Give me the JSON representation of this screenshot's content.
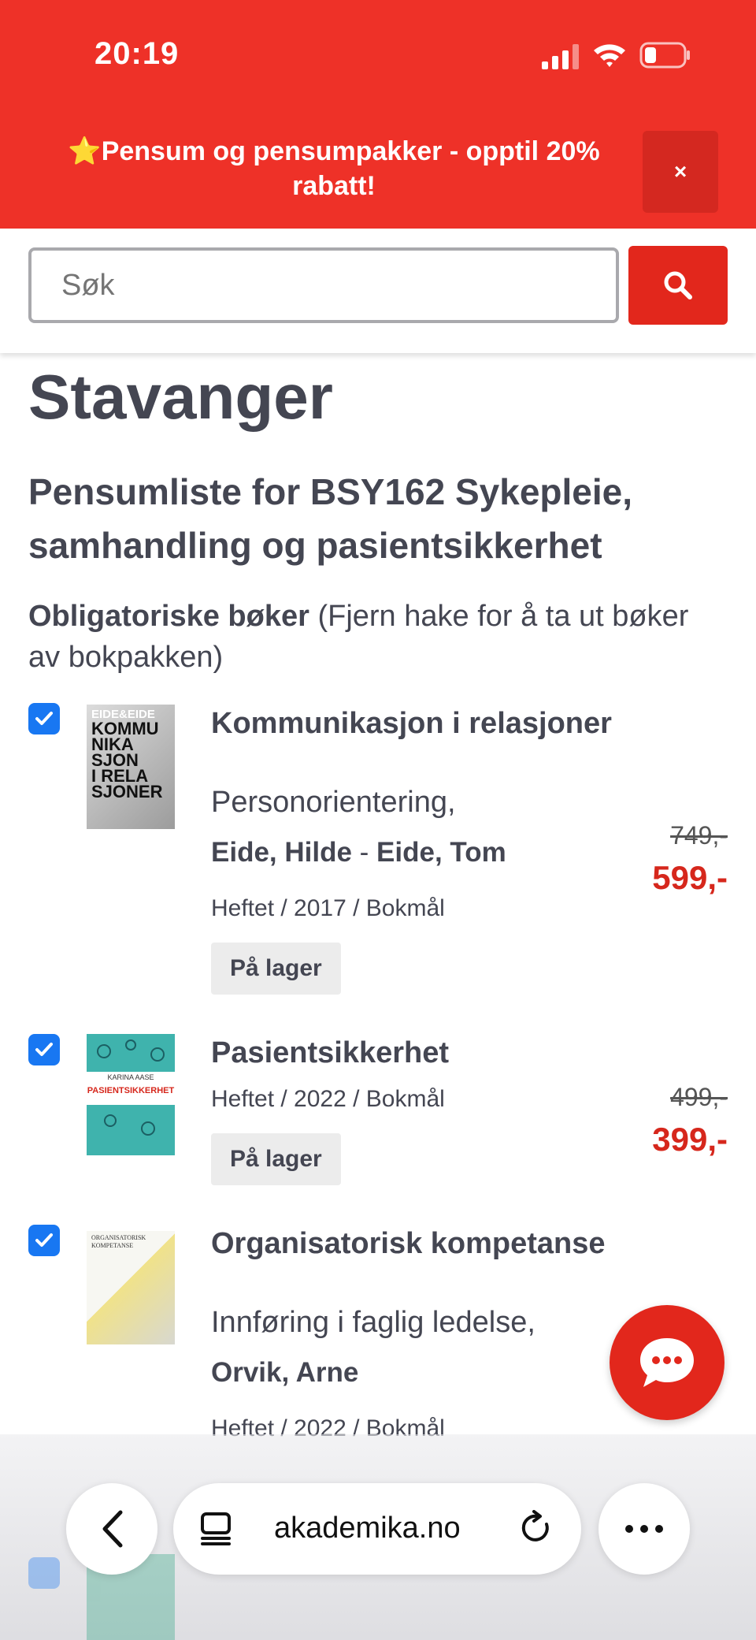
{
  "status_bar": {
    "time": "20:19",
    "icons": [
      "signal-icon",
      "wifi-icon",
      "battery-icon"
    ]
  },
  "promo": {
    "star": "⭐",
    "text": "Pensum og pensumpakker - opptil 20% rabatt!",
    "close": "×"
  },
  "search": {
    "placeholder": "Søk",
    "value": "",
    "button_icon": "search-icon"
  },
  "page": {
    "heading": "Stavanger",
    "subheading": "Pensumliste for BSY162 Sykepleie, samhandling og pasientsikkerhet",
    "section_bold": "Obligatoriske bøker",
    "section_note": " (Fjern hake for å ta ut bøker av bokpakken)"
  },
  "books": [
    {
      "checked": true,
      "cover_text": [
        "EIDE&EIDE",
        "KOMMU",
        "NIKA",
        "SJON",
        "I RELA",
        "SJONER"
      ],
      "title": "Kommunikasjon i relasjoner",
      "subtitle": "Personorientering,",
      "author_1": "Eide, Hilde",
      "author_sep": " - ",
      "author_2": "Eide, Tom",
      "meta": "Heftet / 2017 / Bokmål",
      "stock": "På lager",
      "old_price": "749,-",
      "price": "599,-"
    },
    {
      "checked": true,
      "cover_text": [
        "KARINA AASE",
        "PASIENTSIKKERHET"
      ],
      "title": "Pasientsikkerhet",
      "meta": "Heftet / 2022 / Bokmål",
      "stock": "På lager",
      "old_price": "499,-",
      "price": "399,-"
    },
    {
      "checked": true,
      "cover_text": [
        "ORGANISATORISK",
        "KOMPETANSE"
      ],
      "title": "Organisatorisk kompetanse",
      "subtitle": "Innføring i faglig ledelse,",
      "author_1": "Orvik, Arne",
      "meta": "Heftet / 2022 / Bokmål"
    }
  ],
  "browser": {
    "url": "akademika.no"
  },
  "colors": {
    "brand_red": "#ee3128",
    "price_red": "#d6271c",
    "checkbox_blue": "#1877f2",
    "text": "#444652"
  }
}
